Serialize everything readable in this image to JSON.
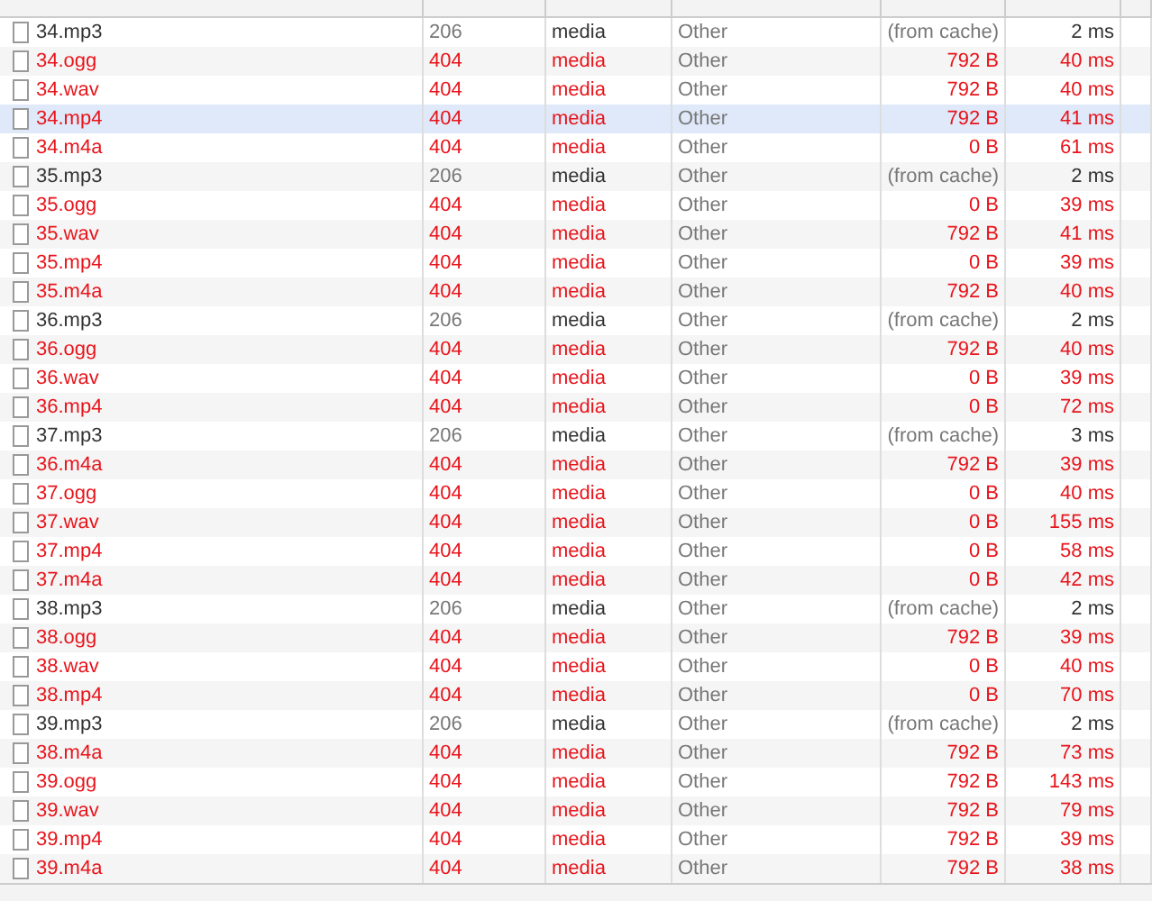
{
  "requests": [
    {
      "name": "34.mp3",
      "status": "206",
      "type": "media",
      "initiator": "Other",
      "size": "(from cache)",
      "time": "2 ms",
      "failed": false,
      "selected": false
    },
    {
      "name": "34.ogg",
      "status": "404",
      "type": "media",
      "initiator": "Other",
      "size": "792 B",
      "time": "40 ms",
      "failed": true,
      "selected": false
    },
    {
      "name": "34.wav",
      "status": "404",
      "type": "media",
      "initiator": "Other",
      "size": "792 B",
      "time": "40 ms",
      "failed": true,
      "selected": false
    },
    {
      "name": "34.mp4",
      "status": "404",
      "type": "media",
      "initiator": "Other",
      "size": "792 B",
      "time": "41 ms",
      "failed": true,
      "selected": true
    },
    {
      "name": "34.m4a",
      "status": "404",
      "type": "media",
      "initiator": "Other",
      "size": "0 B",
      "time": "61 ms",
      "failed": true,
      "selected": false
    },
    {
      "name": "35.mp3",
      "status": "206",
      "type": "media",
      "initiator": "Other",
      "size": "(from cache)",
      "time": "2 ms",
      "failed": false,
      "selected": false
    },
    {
      "name": "35.ogg",
      "status": "404",
      "type": "media",
      "initiator": "Other",
      "size": "0 B",
      "time": "39 ms",
      "failed": true,
      "selected": false
    },
    {
      "name": "35.wav",
      "status": "404",
      "type": "media",
      "initiator": "Other",
      "size": "792 B",
      "time": "41 ms",
      "failed": true,
      "selected": false
    },
    {
      "name": "35.mp4",
      "status": "404",
      "type": "media",
      "initiator": "Other",
      "size": "0 B",
      "time": "39 ms",
      "failed": true,
      "selected": false
    },
    {
      "name": "35.m4a",
      "status": "404",
      "type": "media",
      "initiator": "Other",
      "size": "792 B",
      "time": "40 ms",
      "failed": true,
      "selected": false
    },
    {
      "name": "36.mp3",
      "status": "206",
      "type": "media",
      "initiator": "Other",
      "size": "(from cache)",
      "time": "2 ms",
      "failed": false,
      "selected": false
    },
    {
      "name": "36.ogg",
      "status": "404",
      "type": "media",
      "initiator": "Other",
      "size": "792 B",
      "time": "40 ms",
      "failed": true,
      "selected": false
    },
    {
      "name": "36.wav",
      "status": "404",
      "type": "media",
      "initiator": "Other",
      "size": "0 B",
      "time": "39 ms",
      "failed": true,
      "selected": false
    },
    {
      "name": "36.mp4",
      "status": "404",
      "type": "media",
      "initiator": "Other",
      "size": "0 B",
      "time": "72 ms",
      "failed": true,
      "selected": false
    },
    {
      "name": "37.mp3",
      "status": "206",
      "type": "media",
      "initiator": "Other",
      "size": "(from cache)",
      "time": "3 ms",
      "failed": false,
      "selected": false
    },
    {
      "name": "36.m4a",
      "status": "404",
      "type": "media",
      "initiator": "Other",
      "size": "792 B",
      "time": "39 ms",
      "failed": true,
      "selected": false
    },
    {
      "name": "37.ogg",
      "status": "404",
      "type": "media",
      "initiator": "Other",
      "size": "0 B",
      "time": "40 ms",
      "failed": true,
      "selected": false
    },
    {
      "name": "37.wav",
      "status": "404",
      "type": "media",
      "initiator": "Other",
      "size": "0 B",
      "time": "155 ms",
      "failed": true,
      "selected": false
    },
    {
      "name": "37.mp4",
      "status": "404",
      "type": "media",
      "initiator": "Other",
      "size": "0 B",
      "time": "58 ms",
      "failed": true,
      "selected": false
    },
    {
      "name": "37.m4a",
      "status": "404",
      "type": "media",
      "initiator": "Other",
      "size": "0 B",
      "time": "42 ms",
      "failed": true,
      "selected": false
    },
    {
      "name": "38.mp3",
      "status": "206",
      "type": "media",
      "initiator": "Other",
      "size": "(from cache)",
      "time": "2 ms",
      "failed": false,
      "selected": false
    },
    {
      "name": "38.ogg",
      "status": "404",
      "type": "media",
      "initiator": "Other",
      "size": "792 B",
      "time": "39 ms",
      "failed": true,
      "selected": false
    },
    {
      "name": "38.wav",
      "status": "404",
      "type": "media",
      "initiator": "Other",
      "size": "0 B",
      "time": "40 ms",
      "failed": true,
      "selected": false
    },
    {
      "name": "38.mp4",
      "status": "404",
      "type": "media",
      "initiator": "Other",
      "size": "0 B",
      "time": "70 ms",
      "failed": true,
      "selected": false
    },
    {
      "name": "39.mp3",
      "status": "206",
      "type": "media",
      "initiator": "Other",
      "size": "(from cache)",
      "time": "2 ms",
      "failed": false,
      "selected": false
    },
    {
      "name": "38.m4a",
      "status": "404",
      "type": "media",
      "initiator": "Other",
      "size": "792 B",
      "time": "73 ms",
      "failed": true,
      "selected": false
    },
    {
      "name": "39.ogg",
      "status": "404",
      "type": "media",
      "initiator": "Other",
      "size": "792 B",
      "time": "143 ms",
      "failed": true,
      "selected": false
    },
    {
      "name": "39.wav",
      "status": "404",
      "type": "media",
      "initiator": "Other",
      "size": "792 B",
      "time": "79 ms",
      "failed": true,
      "selected": false
    },
    {
      "name": "39.mp4",
      "status": "404",
      "type": "media",
      "initiator": "Other",
      "size": "792 B",
      "time": "39 ms",
      "failed": true,
      "selected": false
    },
    {
      "name": "39.m4a",
      "status": "404",
      "type": "media",
      "initiator": "Other",
      "size": "792 B",
      "time": "38 ms",
      "failed": true,
      "selected": false
    }
  ]
}
